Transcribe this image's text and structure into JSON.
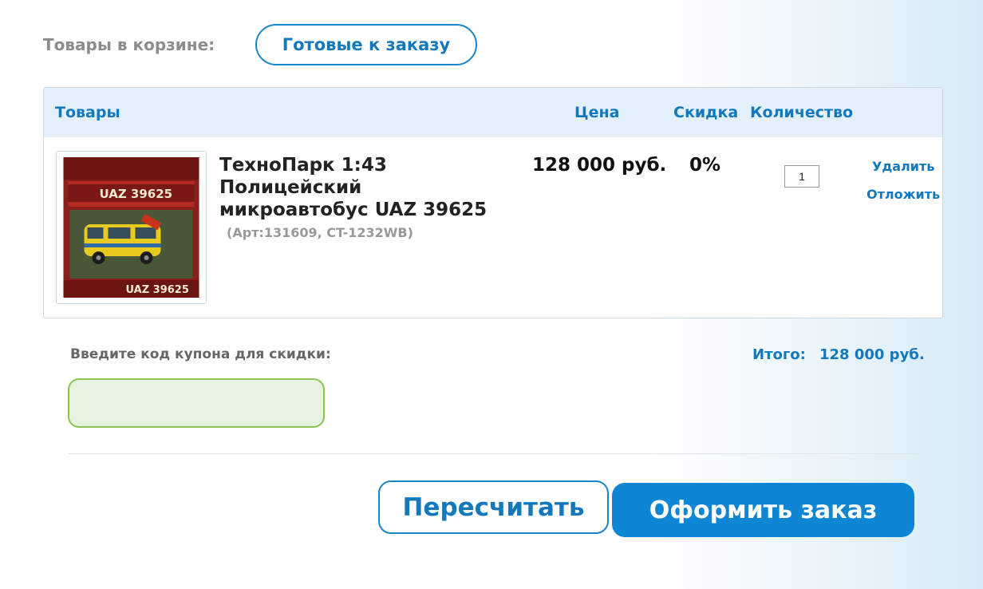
{
  "header": {
    "cart_label": "Товары в корзине:",
    "ready_tab_label": "Готовые к заказу"
  },
  "table": {
    "columns": {
      "goods": "Товары",
      "price": "Цена",
      "discount": "Скидка",
      "quantity": "Количество"
    },
    "items": [
      {
        "image_text_top": "UAZ 39625",
        "image_text_bottom": "UAZ 39625",
        "title": "ТехноПарк 1:43 Полицейский микроавтобус UAZ 39625",
        "sku": "(Арт:131609, CT-1232WB)",
        "price": "128 000 руб.",
        "discount": "0%",
        "quantity": "1",
        "delete_label": "Удалить",
        "postpone_label": "Отложить"
      }
    ]
  },
  "coupon": {
    "label": "Введите код купона для скидки:",
    "value": ""
  },
  "total": {
    "label": "Итого:",
    "value": "128 000 руб."
  },
  "buttons": {
    "recalc": "Пересчитать",
    "checkout": "Оформить заказ"
  },
  "colors": {
    "accent": "#1478bd",
    "checkout_bg": "#0e86d4",
    "coupon_border": "#88c553",
    "coupon_bg": "#e6f4df",
    "header_bg": "#e4f0f9"
  }
}
